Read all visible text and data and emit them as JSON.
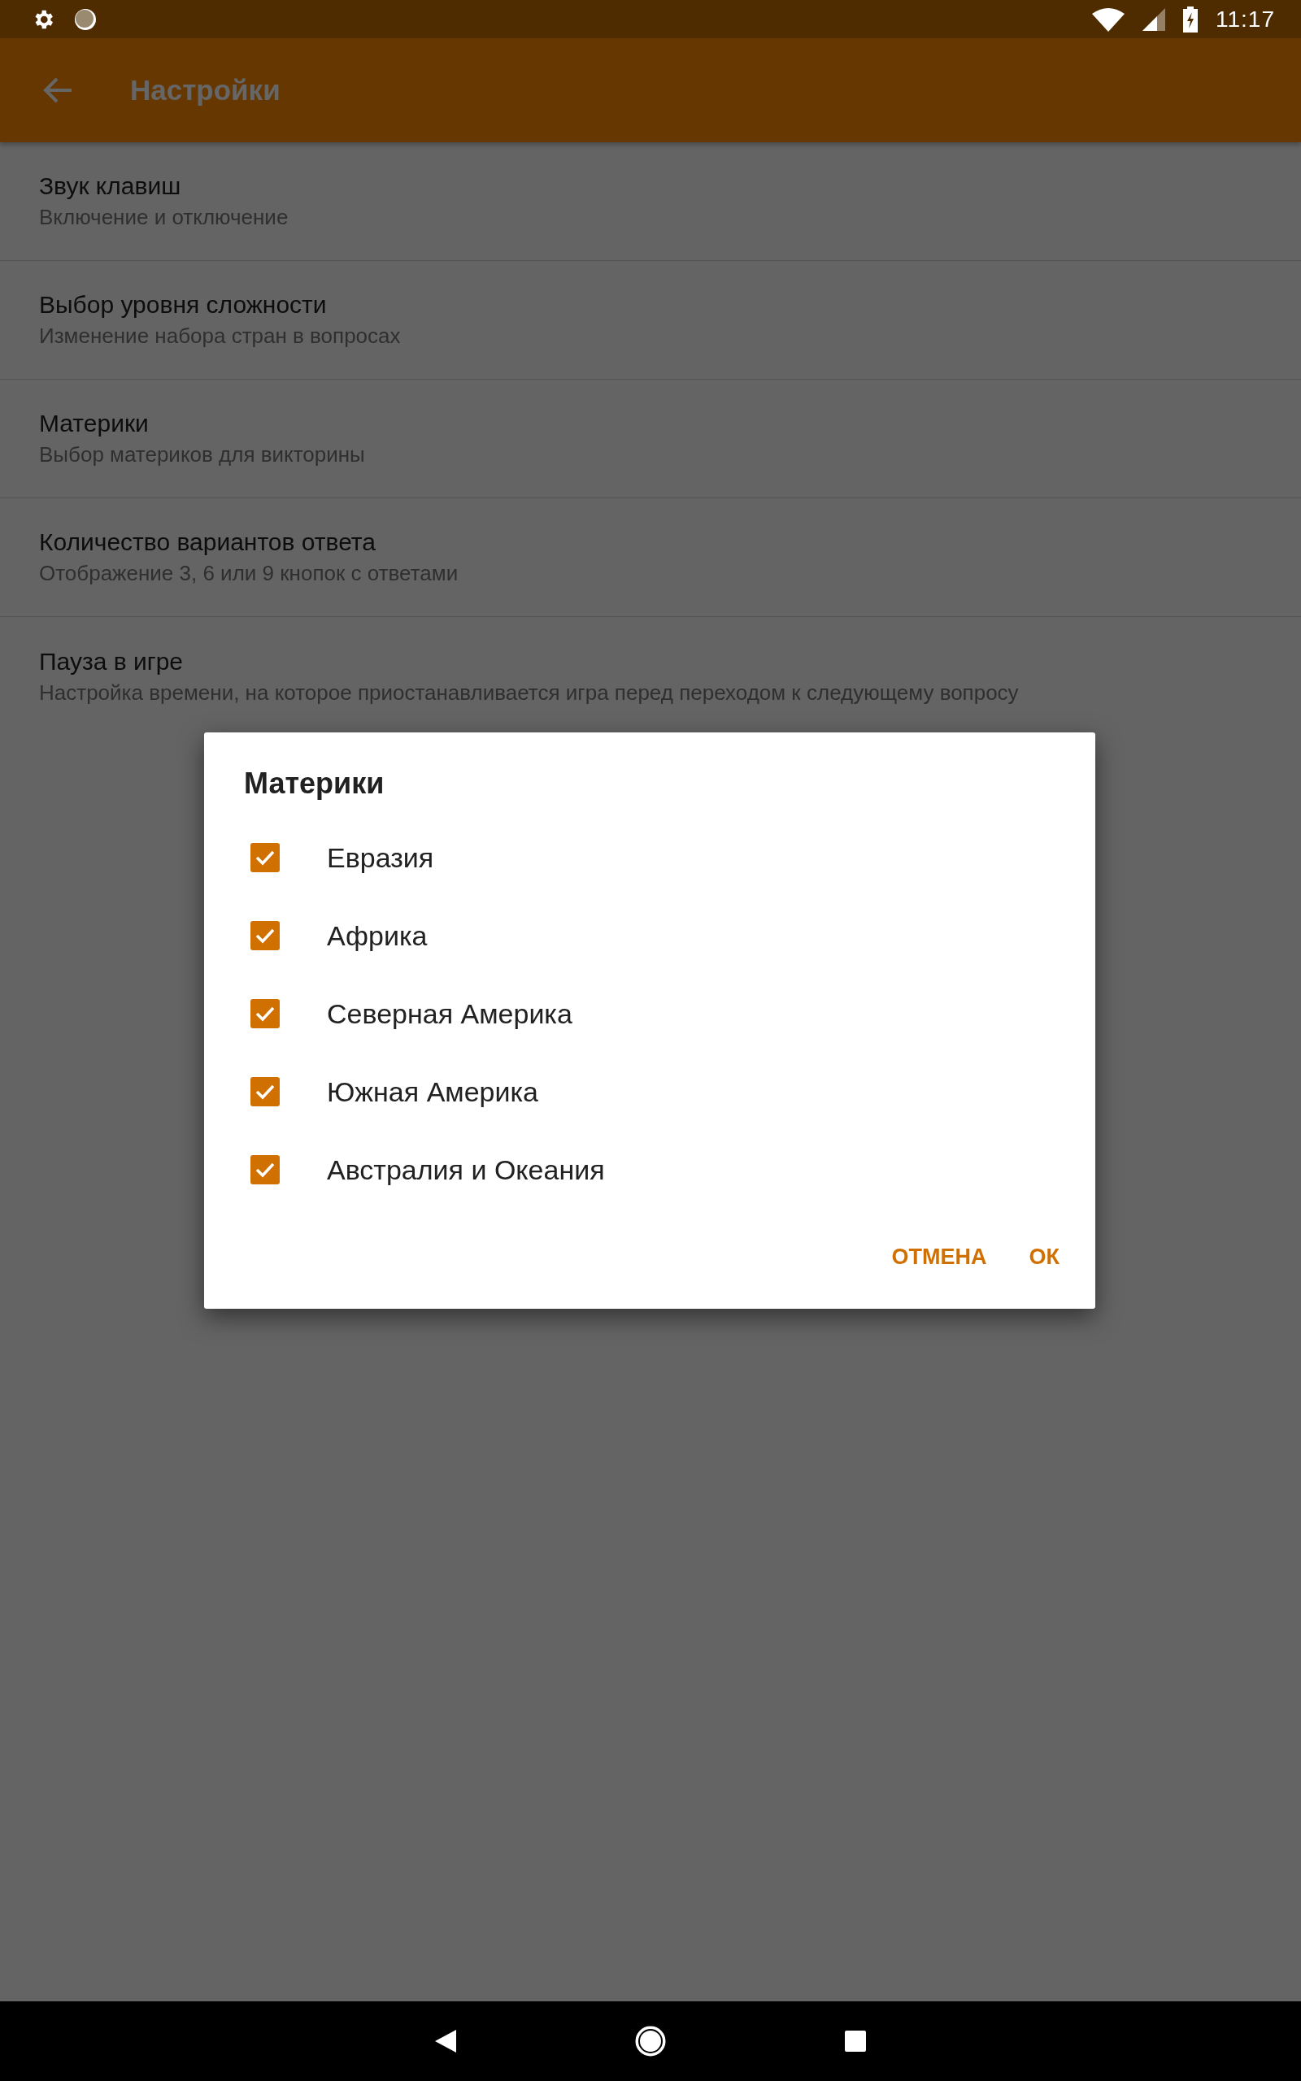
{
  "status_bar": {
    "time": "11:17"
  },
  "app_bar": {
    "title": "Настройки"
  },
  "preferences": [
    {
      "title": "Звук клавиш",
      "summary": "Включение и отключение"
    },
    {
      "title": "Выбор уровня сложности",
      "summary": "Изменение набора стран в вопросах"
    },
    {
      "title": "Материки",
      "summary": "Выбор материков для викторины"
    },
    {
      "title": "Количество вариантов ответа",
      "summary": "Отображение 3, 6 или 9 кнопок с ответами"
    },
    {
      "title": "Пауза в игре",
      "summary": "Настройка времени, на которое приостанавливается игра перед переходом к следующему вопросу"
    }
  ],
  "dialog": {
    "title": "Материки",
    "options": [
      {
        "label": "Евразия",
        "checked": true
      },
      {
        "label": "Африка",
        "checked": true
      },
      {
        "label": "Северная Америка",
        "checked": true
      },
      {
        "label": "Южная Америка",
        "checked": true
      },
      {
        "label": "Австралия и Океания",
        "checked": true
      }
    ],
    "buttons": [
      "ОТМЕНА",
      "ОК"
    ]
  }
}
